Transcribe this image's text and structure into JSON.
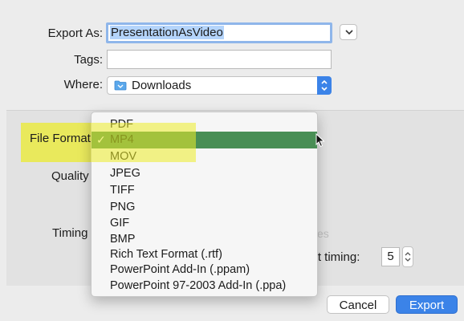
{
  "form": {
    "export_as_label": "Export As:",
    "export_as_value": "PresentationAsVideo",
    "tags_label": "Tags:",
    "tags_value": "",
    "where_label": "Where:",
    "where_value": "Downloads",
    "where_icon": "folder-icon"
  },
  "options": {
    "file_format_label": "File Format",
    "quality_label": "Quality",
    "timing_label": "Timing",
    "faded_text": "es",
    "reset_timing_label": "set timing:",
    "reset_timing_value": "5"
  },
  "format_menu": {
    "selected": "MP4",
    "checkmark": "✓",
    "items": [
      "PDF",
      "MP4",
      "MOV",
      "JPEG",
      "TIFF",
      "PNG",
      "GIF",
      "BMP",
      "Rich Text Format (.rtf)",
      "PowerPoint Add-In (.ppam)",
      "PowerPoint 97-2003 Add-In (.ppa)"
    ]
  },
  "buttons": {
    "cancel": "Cancel",
    "export": "Export"
  },
  "colors": {
    "accent": "#3b83e8",
    "selected_row": "#3a8446",
    "annotation_highlight": "#ecec28"
  }
}
